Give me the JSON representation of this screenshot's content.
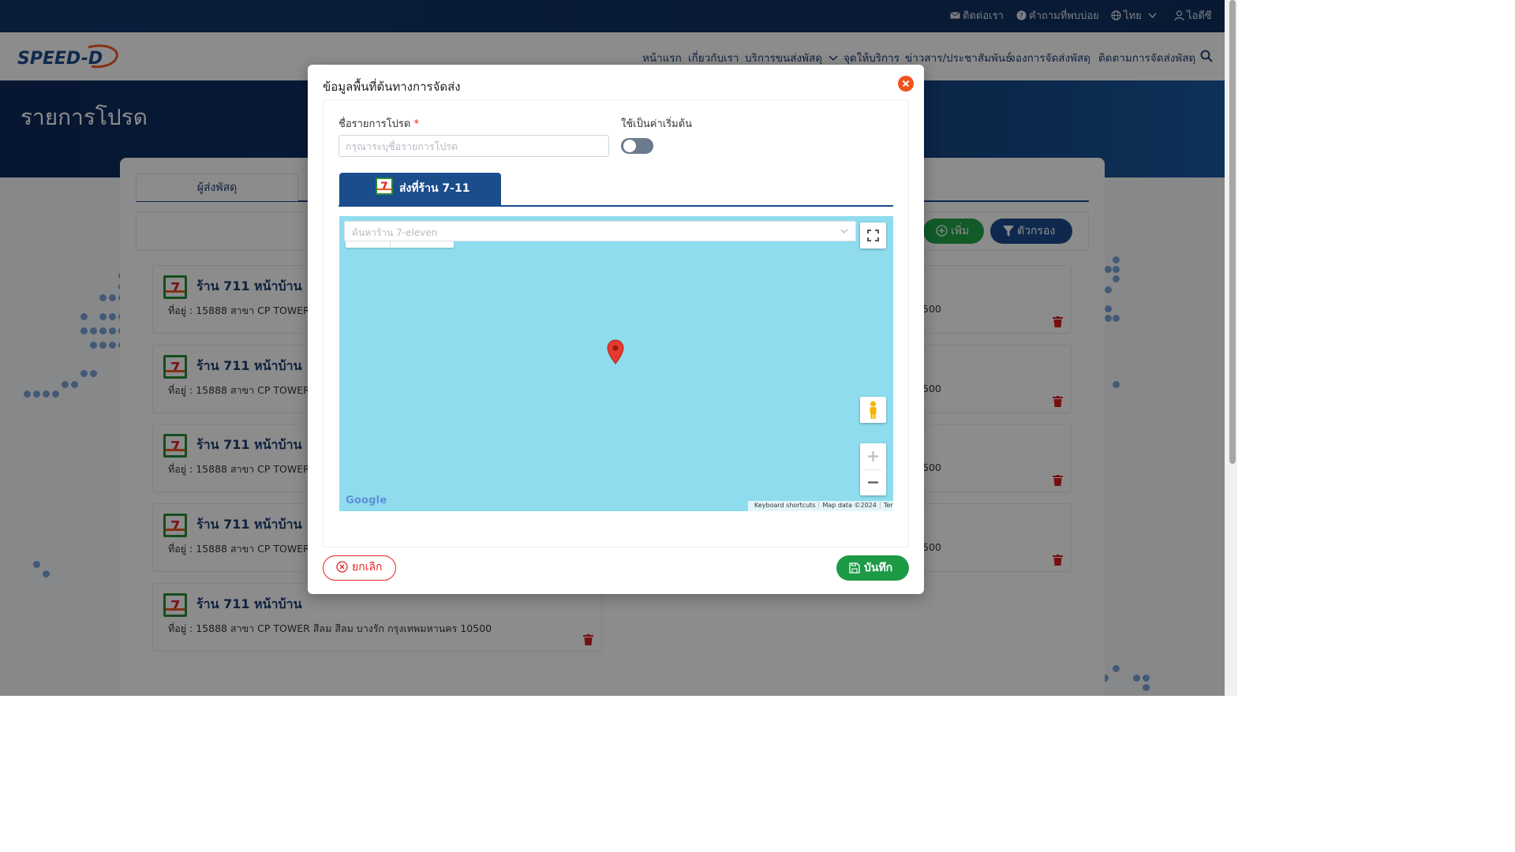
{
  "topbar": {
    "contact": "ติดต่อเรา",
    "faq": "คำถามที่พบบ่อย",
    "language": "ไทย",
    "user": "ไอดีซี"
  },
  "nav": {
    "logo_text": "SPEED-D",
    "items": [
      "หน้าแรก",
      "เกี่ยวกับเรา",
      "บริการขนส่งพัสดุ",
      "จุดให้บริการ",
      "ข่าวสาร/ประชาสัมพันธ์",
      "จองการจัดส่งพัสดุ",
      "ติดตามการจัดส่งพัสดุ"
    ]
  },
  "hero": {
    "title": "รายการโปรด"
  },
  "page": {
    "tab_sender": "ผู้ส่งพัสดุ",
    "add_button": "เพิ่ม",
    "filter_button": "ตัวกรอง",
    "favorites": [
      {
        "name": "ร้าน 711 หน้าบ้าน",
        "address": "ที่อยู่ : 15888 สาขา CP TOWER สี",
        "address_tail": "500"
      },
      {
        "name": "ร้าน 711 หน้าบ้าน",
        "address": "ที่อยู่ : 15888 สาขา CP TOWER สี",
        "address_tail": "500"
      },
      {
        "name": "ร้าน 711 หน้าบ้าน",
        "address": "ที่อยู่ : 15888 สาขา CP TOWER สี",
        "address_tail": "500"
      },
      {
        "name": "ร้าน 711 หน้าบ้าน",
        "address": "ที่อยู่ : 15888 สาขา CP TOWER สี",
        "address_tail": "500"
      },
      {
        "name": "ร้าน 711 หน้าบ้าน",
        "address": "ที่อยู่ : 15888 สาขา CP TOWER สีลม สีลม บางรัก กรุงเทพมหานคร 10500"
      }
    ]
  },
  "modal": {
    "title": "ข้อมูลพื้นที่ต้นทางการจัดส่ง",
    "name_label": "ชื่อรายการโปรด",
    "required_mark": "*",
    "name_placeholder": "กรุณาระบุชื่อรายการโปรด",
    "name_value": "",
    "default_label": "ใช้เป็นค่าเริ่มต้น",
    "default_on": false,
    "tab_label": "ส่งที่ร้าน 7-11",
    "map": {
      "search_placeholder": "ค้นหาร้าน 7-eleven",
      "footer": [
        "Keyboard shortcuts",
        "Map data ©2024",
        "Terms"
      ],
      "brand": "Google"
    },
    "cancel_label": "ยกเลิก",
    "save_label": "บันทึก"
  },
  "colors": {
    "primary": "#1b4c8c",
    "success": "#1c9a45",
    "danger": "#e02424",
    "close": "#f0541e",
    "map_water": "#8fdcef"
  }
}
